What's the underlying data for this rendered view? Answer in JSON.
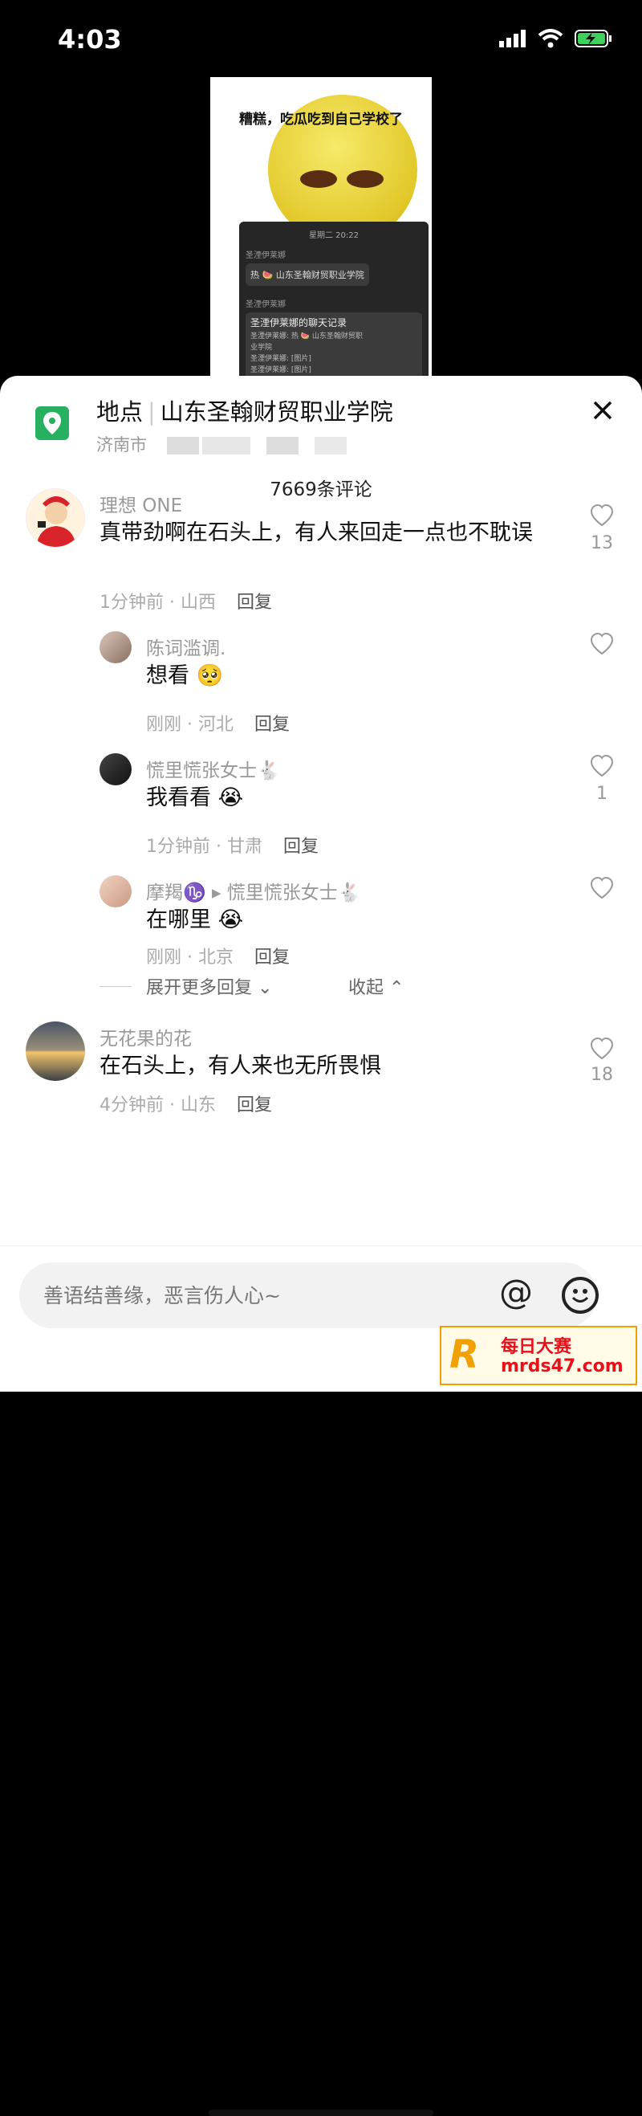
{
  "status": {
    "time": "4:03"
  },
  "video": {
    "title": "糟糕，吃瓜吃到自己学校了",
    "chat_time": "星期二 20:22",
    "sender1": "圣湮伊莱娜",
    "hot_msg": "热 🍉 山东圣翰财贸职业学院",
    "sender2": "圣湮伊莱娜",
    "record_title": "圣湮伊莱娜的聊天记录",
    "record_lines": [
      "圣湮伊莱娜: 热 🍉 山东圣翰财贸职",
      "业学院",
      "圣湮伊莱娜: [图片]",
      "圣湮伊莱娜: [图片]"
    ]
  },
  "location": {
    "label": "地点",
    "name": "山东圣翰财贸职业学院",
    "city": "济南市"
  },
  "comments_count": "7669条评论",
  "comments": [
    {
      "user": "理想 ONE",
      "text": "真带劲啊在石头上，有人来回走一点也不耽误",
      "time": "1分钟前 · 山西",
      "reply": "回复",
      "likes": "13"
    },
    {
      "user": "陈词滥调.",
      "text": "想看 🥺",
      "time": "刚刚 · 河北",
      "reply": "回复",
      "likes": ""
    },
    {
      "user": "慌里慌张女士🐇",
      "text": "我看看 😭",
      "time": "1分钟前 · 甘肃",
      "reply": "回复",
      "likes": "1"
    },
    {
      "user": "摩羯♑️",
      "reply_to": "▸ 慌里慌张女士🐇",
      "text": "在哪里 😭",
      "time": "刚刚 · 北京",
      "reply": "回复",
      "likes": ""
    },
    {
      "user": "无花果的花",
      "text": "在石头上，有人来也无所畏惧",
      "time": "4分钟前 · 山东",
      "reply": "回复",
      "likes": "18"
    }
  ],
  "expand": {
    "more": "展开更多回复 ⌄",
    "collapse": "收起 ⌃"
  },
  "input": {
    "placeholder": "善语结善缘，恶言伤人心~",
    "at": "@"
  },
  "watermark": {
    "line1": "每日大赛",
    "line2": "mrds47.com"
  },
  "colors": {
    "location_icon": "#27b05f",
    "watermark": "#e8101a"
  }
}
